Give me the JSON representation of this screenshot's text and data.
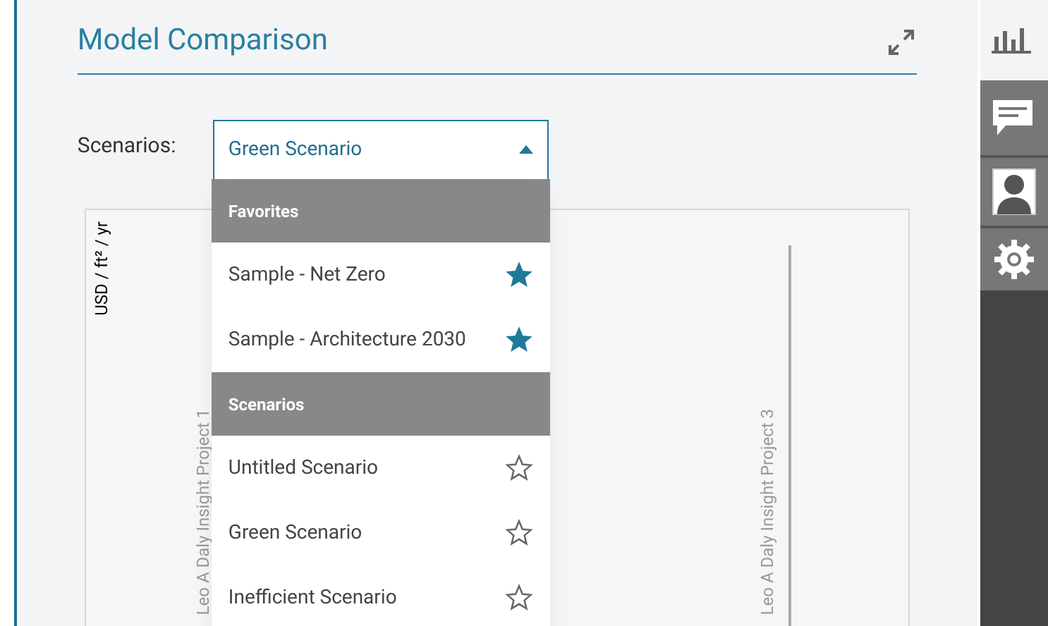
{
  "panel": {
    "title": "Model Comparison"
  },
  "scenario_select": {
    "label": "Scenarios:",
    "value": "Green Scenario",
    "expanded": true
  },
  "dropdown": [
    {
      "header": "Favorites",
      "items": [
        {
          "label": "Sample - Net Zero",
          "favorite": true
        },
        {
          "label": "Sample - Architecture 2030",
          "favorite": true
        }
      ]
    },
    {
      "header": "Scenarios",
      "items": [
        {
          "label": "Untitled Scenario",
          "favorite": false
        },
        {
          "label": "Green Scenario",
          "favorite": false
        },
        {
          "label": "Inefficient Scenario",
          "favorite": false
        }
      ]
    }
  ],
  "chart": {
    "ylabel": "USD / ft² / yr",
    "projects": [
      "Leo A Daly Insight Project 1",
      "Leo A Daly Insight Project 3"
    ]
  }
}
